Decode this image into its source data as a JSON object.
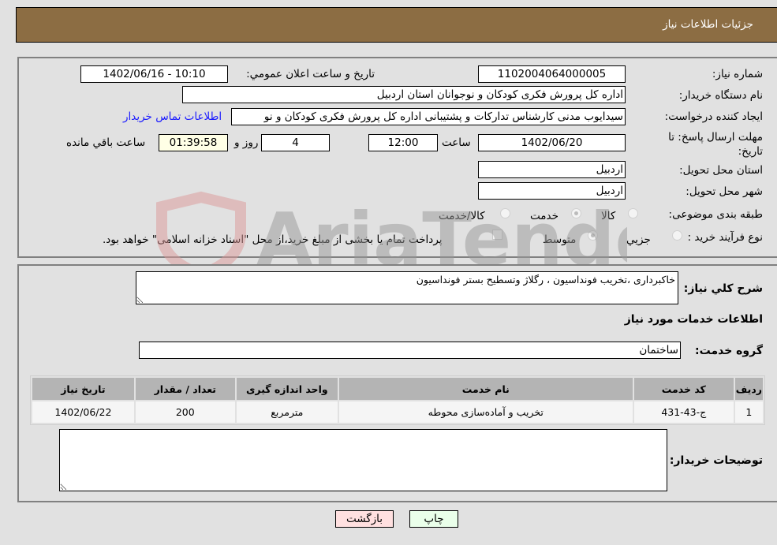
{
  "header": {
    "title": "جزئيات اطلاعات نياز"
  },
  "form": {
    "need_number": {
      "label": "شماره نياز:",
      "value": "1102004064000005"
    },
    "announce_datetime": {
      "label": "تاريخ و ساعت اعلان عمومي:",
      "value": "1402/06/16 - 10:10"
    },
    "buyer_org": {
      "label": "نام دستگاه خريدار:",
      "value": "اداره کل پرورش فکری کودکان و نوجوانان استان اردبیل"
    },
    "requester": {
      "label": "ايجاد کننده درخواست:",
      "value": "سیدایوب مدنی کارشناس تدارکات و پشتیبانی اداره کل پرورش فکری کودکان و نو"
    },
    "buyer_contact_link": "اطلاعات تماس خريدار",
    "deadline": {
      "label": "مهلت ارسال پاسخ: تا تاريخ:",
      "date": "1402/06/20",
      "time_label": "ساعت",
      "time": "12:00",
      "days": "4",
      "days_label": "روز و",
      "remaining": "01:39:58",
      "remaining_label": "ساعت باقي مانده"
    },
    "delivery_province": {
      "label": "استان محل تحويل:",
      "value": "اردبیل"
    },
    "delivery_city": {
      "label": "شهر محل تحويل:",
      "value": "اردبیل"
    },
    "category": {
      "label": "طبقه بندی موضوعی:",
      "options": [
        "کالا",
        "خدمت",
        "کالا/خدمت"
      ],
      "selected": "خدمت"
    },
    "purchase_type": {
      "label": "نوع فرآيند خريد :",
      "options": [
        "جزيي",
        "متوسط"
      ],
      "selected": "متوسط",
      "treasury_note": "پرداخت تمام يا بخشی از مبلغ خريد،از محل \"اسناد خزانه اسلامی\" خواهد بود."
    }
  },
  "details": {
    "description_label": "شرح كلي نياز:",
    "description_value": "خاکبرداری ،تخریب فونداسیون ، رگلاژ وتسطیح بستر فونداسیون",
    "services_heading": "اطلاعات خدمات مورد نياز",
    "service_group_label": "گروه خدمت:",
    "service_group_value": "ساختمان",
    "table": {
      "headers": [
        "رديف",
        "کد خدمت",
        "نام خدمت",
        "واحد اندازه گيری",
        "تعداد / مقدار",
        "تاريخ نياز"
      ],
      "rows": [
        [
          "1",
          "ج-43-431",
          "تخریب و آماده‌سازی محوطه",
          "مترمربع",
          "200",
          "1402/06/22"
        ]
      ]
    },
    "buyer_notes_label": "توضيحات خريدار:",
    "buyer_notes_value": ""
  },
  "buttons": {
    "print": "چاپ",
    "back": "بازگشت"
  },
  "watermark": {
    "text": "AriaTender.neT"
  }
}
